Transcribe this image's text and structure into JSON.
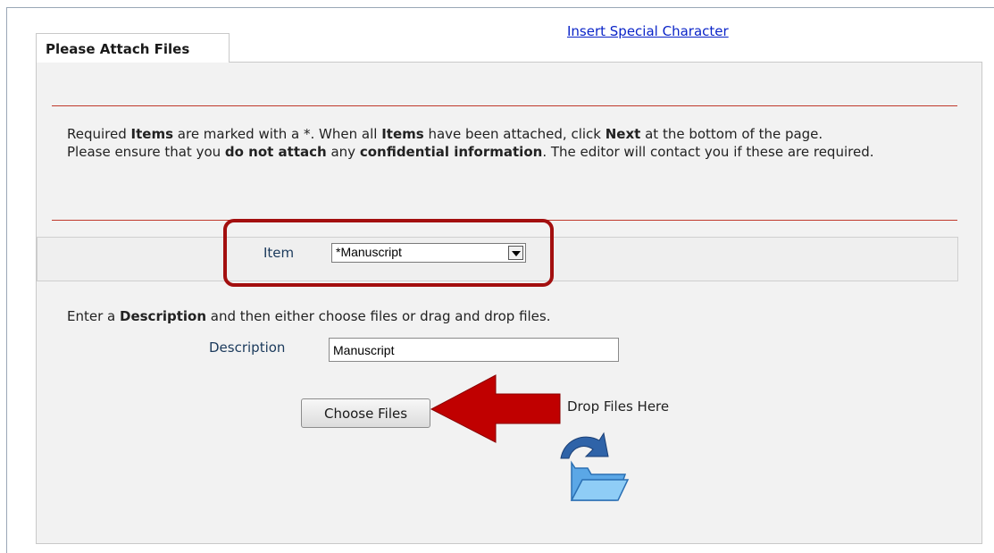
{
  "header": {
    "special_character_link": "Insert Special Character"
  },
  "tab": {
    "title": "Please Attach Files"
  },
  "instructions": {
    "line1_part1": "Required ",
    "line1_bold1": "Items",
    "line1_part2": " are marked with a *. When all ",
    "line1_bold2": "Items",
    "line1_part3": " have been attached, click ",
    "line1_bold3": "Next",
    "line1_part4": " at the bottom of the page.",
    "line2_part1": "Please ensure that you ",
    "line2_bold1": "do not attach",
    "line2_part2": " any ",
    "line2_bold2": "confidential information",
    "line2_part3": ". The editor will contact you if these are required."
  },
  "item_select": {
    "label": "Item",
    "selected": "*Manuscript"
  },
  "description_prompt": {
    "part1": "Enter a ",
    "bold": "Description",
    "part2": " and then either choose files or drag and drop files."
  },
  "description_field": {
    "label": "Description",
    "value": "Manuscript"
  },
  "upload": {
    "choose_button": "Choose Files",
    "drop_label": "Drop Files Here"
  },
  "colors": {
    "highlight": "#a30f0f",
    "link": "#0a24c8",
    "rule": "#c0392b"
  },
  "icons": {
    "folder": "folder-drop-icon",
    "pointer": "red-arrow-icon"
  }
}
